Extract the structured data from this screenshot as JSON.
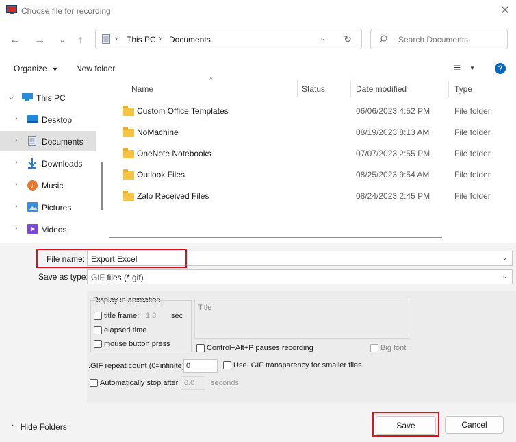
{
  "window": {
    "title": "Choose file for recording"
  },
  "address": {
    "crumbs": [
      "This PC",
      "Documents"
    ]
  },
  "search": {
    "placeholder": "Search Documents"
  },
  "toolbar": {
    "organize": "Organize",
    "new_folder": "New folder"
  },
  "nav_tree": [
    {
      "label": "This PC",
      "expanded": true
    },
    {
      "label": "Desktop"
    },
    {
      "label": "Documents",
      "selected": true
    },
    {
      "label": "Downloads"
    },
    {
      "label": "Music"
    },
    {
      "label": "Pictures"
    },
    {
      "label": "Videos"
    }
  ],
  "columns": {
    "name": "Name",
    "status": "Status",
    "date": "Date modified",
    "type": "Type"
  },
  "files": [
    {
      "name": "Custom Office Templates",
      "date": "06/06/2023 4:52 PM",
      "type": "File folder"
    },
    {
      "name": "NoMachine",
      "date": "08/19/2023 8:13 AM",
      "type": "File folder"
    },
    {
      "name": "OneNote Notebooks",
      "date": "07/07/2023 2:55 PM",
      "type": "File folder"
    },
    {
      "name": "Outlook Files",
      "date": "08/25/2023 9:54 AM",
      "type": "File folder"
    },
    {
      "name": "Zalo Received Files",
      "date": "08/24/2023 2:45 PM",
      "type": "File folder"
    }
  ],
  "form": {
    "file_name_label": "File name:",
    "file_name_value": "Export Excel",
    "save_type_label": "Save as type:",
    "save_type_value": "GIF files (*.gif)"
  },
  "options": {
    "display_group": "Display in animation",
    "title_frame": "title frame:",
    "title_frame_value": "1.8",
    "sec": "sec",
    "elapsed_time": "elapsed time",
    "mouse_press": "mouse button press",
    "title_group": "Title",
    "ctrl_alt_p": "Control+Alt+P pauses recording",
    "big_font": "Big font",
    "repeat_label": ".GIF repeat count (0=infinite):",
    "repeat_value": "0",
    "transparency": "Use .GIF transparency for smaller files",
    "auto_stop": "Automatically stop after",
    "auto_stop_value": "0.0",
    "seconds": "seconds"
  },
  "footer": {
    "hide_folders": "Hide Folders",
    "save": "Save",
    "cancel": "Cancel"
  },
  "colors": {
    "accent": "#0067c0",
    "highlight": "#e0101a",
    "folder": "#f6c443"
  }
}
